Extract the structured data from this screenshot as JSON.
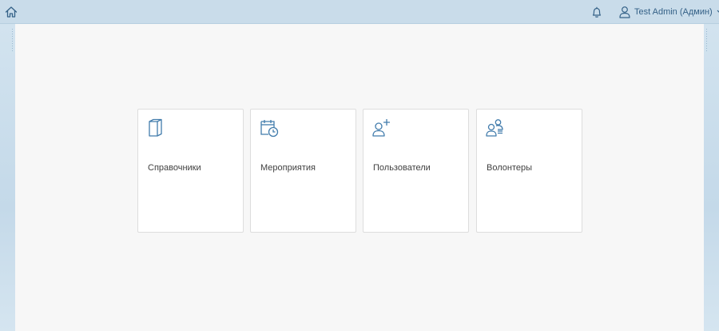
{
  "shellbar": {
    "home_icon": "home-icon",
    "notifications_icon": "bell-icon",
    "user": {
      "icon": "user-icon",
      "name": "Test Admin (Админ)",
      "menu_icon": "chevron-down-icon"
    }
  },
  "colors": {
    "shell_bg": "#c9dcea",
    "accent": "#346187",
    "tile_icon": "#427cac",
    "content_bg": "#f7f7f7"
  },
  "tiles": [
    {
      "title": "Справочники",
      "icon": "book-icon"
    },
    {
      "title": "Мероприятия",
      "icon": "calendar-clock-icon"
    },
    {
      "title": "Пользователи",
      "icon": "add-user-icon"
    },
    {
      "title": "Волонтеры",
      "icon": "user-group-icon"
    }
  ]
}
